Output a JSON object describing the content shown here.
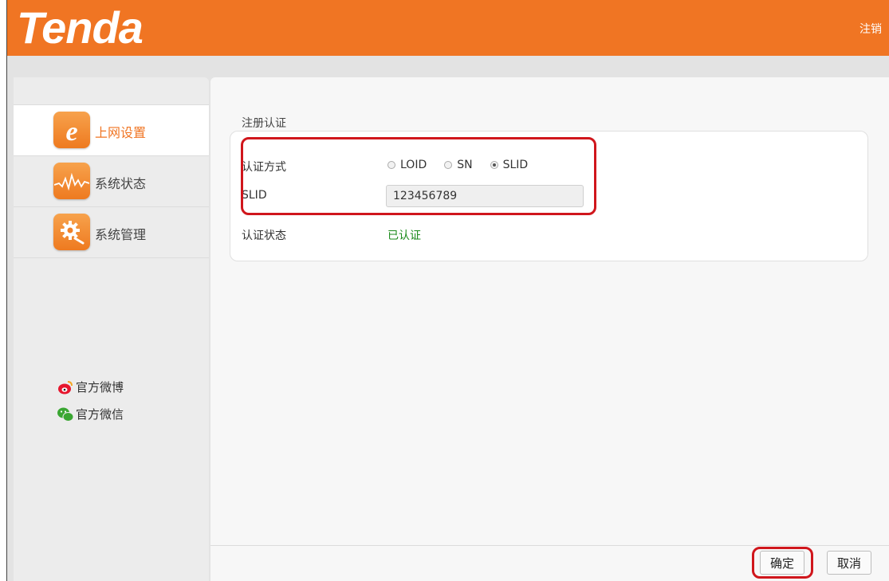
{
  "header": {
    "logo_text": "Tenda",
    "logout_label": "注销",
    "bg_color": "#f07523"
  },
  "sidebar": {
    "items": [
      {
        "label": "上网设置",
        "icon": "ie-icon",
        "active": true
      },
      {
        "label": "系统状态",
        "icon": "pulse-icon",
        "active": false
      },
      {
        "label": "系统管理",
        "icon": "gear-icon",
        "active": false
      }
    ],
    "social": [
      {
        "label": "官方微博",
        "icon": "weibo-icon"
      },
      {
        "label": "官方微信",
        "icon": "wechat-icon"
      }
    ]
  },
  "main": {
    "section_title": "注册认证",
    "auth_method": {
      "label": "认证方式",
      "options": [
        {
          "label": "LOID",
          "checked": false
        },
        {
          "label": "SN",
          "checked": false
        },
        {
          "label": "SLID",
          "checked": true
        }
      ]
    },
    "slid": {
      "label": "SLID",
      "value": "123456789"
    },
    "auth_status": {
      "label": "认证状态",
      "value": "已认证",
      "color": "#1a8a1a"
    },
    "buttons": {
      "confirm_label": "确定",
      "cancel_label": "取消"
    },
    "highlight_color": "#d0161c"
  }
}
